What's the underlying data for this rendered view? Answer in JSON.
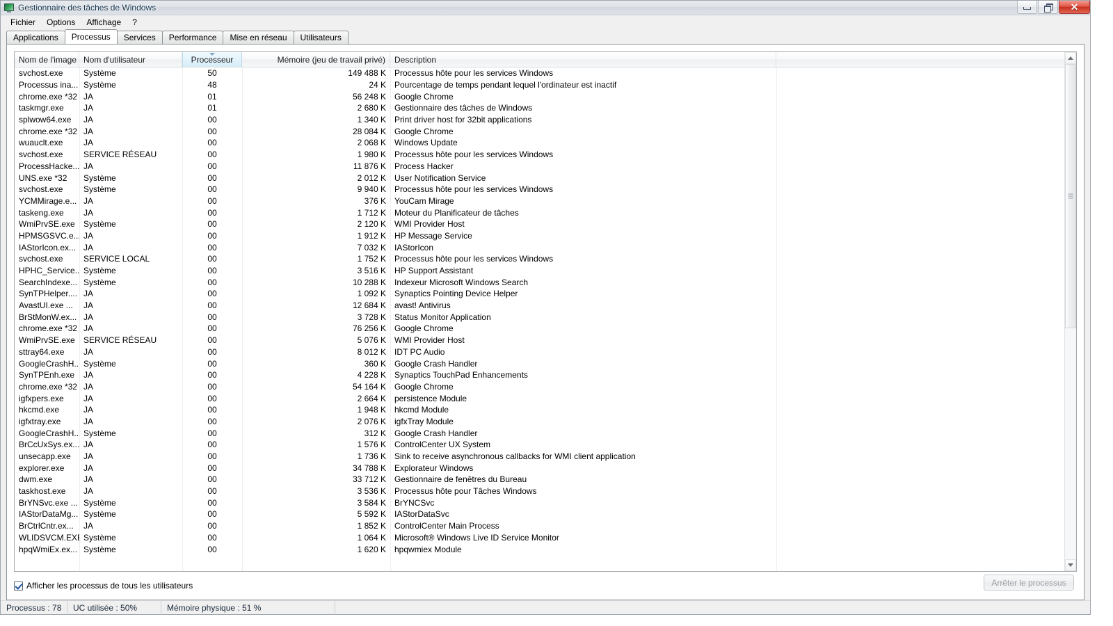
{
  "window": {
    "title": "Gestionnaire des tâches de Windows",
    "icon": "task-manager-icon",
    "minimize_label": "Réduire",
    "restore_label": "Agrandir",
    "close_label": "Fermer",
    "close_glyph": "✕"
  },
  "menu": {
    "items": [
      {
        "label": "Fichier"
      },
      {
        "label": "Options"
      },
      {
        "label": "Affichage"
      },
      {
        "label": "?"
      }
    ]
  },
  "tabs": [
    {
      "label": "Applications",
      "active": false
    },
    {
      "label": "Processus",
      "active": true
    },
    {
      "label": "Services",
      "active": false
    },
    {
      "label": "Performance",
      "active": false
    },
    {
      "label": "Mise en réseau",
      "active": false
    },
    {
      "label": "Utilisateurs",
      "active": false
    }
  ],
  "table": {
    "columns": [
      {
        "key": "name",
        "label": "Nom de l'image",
        "align": "left"
      },
      {
        "key": "user",
        "label": "Nom d'utilisateur",
        "align": "left"
      },
      {
        "key": "cpu",
        "label": "Processeur",
        "align": "center",
        "sorted": true,
        "sort_direction": "descending"
      },
      {
        "key": "mem",
        "label": "Mémoire (jeu de travail privé)",
        "align": "right"
      },
      {
        "key": "desc",
        "label": "Description",
        "align": "left"
      }
    ],
    "rows": [
      {
        "name": "svchost.exe",
        "user": "Système",
        "cpu": "50",
        "mem": "149 488 K",
        "desc": "Processus hôte pour les services Windows"
      },
      {
        "name": "Processus ina...",
        "user": "Système",
        "cpu": "48",
        "mem": "24 K",
        "desc": "Pourcentage de temps pendant lequel l'ordinateur est inactif"
      },
      {
        "name": "chrome.exe *32",
        "user": "JA",
        "cpu": "01",
        "mem": "56 248 K",
        "desc": "Google Chrome"
      },
      {
        "name": "taskmgr.exe",
        "user": "JA",
        "cpu": "01",
        "mem": "2 680 K",
        "desc": "Gestionnaire des tâches de Windows"
      },
      {
        "name": "splwow64.exe",
        "user": "JA",
        "cpu": "00",
        "mem": "1 340 K",
        "desc": "Print driver host for 32bit applications"
      },
      {
        "name": "chrome.exe *32",
        "user": "JA",
        "cpu": "00",
        "mem": "28 084 K",
        "desc": "Google Chrome"
      },
      {
        "name": "wuauclt.exe",
        "user": "JA",
        "cpu": "00",
        "mem": "2 068 K",
        "desc": "Windows Update"
      },
      {
        "name": "svchost.exe",
        "user": "SERVICE RÉSEAU",
        "cpu": "00",
        "mem": "1 980 K",
        "desc": "Processus hôte pour les services Windows"
      },
      {
        "name": "ProcessHacke...",
        "user": "JA",
        "cpu": "00",
        "mem": "11 876 K",
        "desc": "Process Hacker"
      },
      {
        "name": "UNS.exe *32",
        "user": "Système",
        "cpu": "00",
        "mem": "2 012 K",
        "desc": "User Notification Service"
      },
      {
        "name": "svchost.exe",
        "user": "Système",
        "cpu": "00",
        "mem": "9 940 K",
        "desc": "Processus hôte pour les services Windows"
      },
      {
        "name": "YCMMirage.e...",
        "user": "JA",
        "cpu": "00",
        "mem": "376 K",
        "desc": "YouCam Mirage"
      },
      {
        "name": "taskeng.exe",
        "user": "JA",
        "cpu": "00",
        "mem": "1 712 K",
        "desc": "Moteur du Planificateur de tâches"
      },
      {
        "name": "WmiPrvSE.exe",
        "user": "Système",
        "cpu": "00",
        "mem": "2 120 K",
        "desc": "WMI Provider Host"
      },
      {
        "name": "HPMSGSVC.e...",
        "user": "JA",
        "cpu": "00",
        "mem": "1 912 K",
        "desc": "HP Message Service"
      },
      {
        "name": "IAStorIcon.ex...",
        "user": "JA",
        "cpu": "00",
        "mem": "7 032 K",
        "desc": "IAStorIcon"
      },
      {
        "name": "svchost.exe",
        "user": "SERVICE LOCAL",
        "cpu": "00",
        "mem": "1 752 K",
        "desc": "Processus hôte pour les services Windows"
      },
      {
        "name": "HPHC_Service...",
        "user": "Système",
        "cpu": "00",
        "mem": "3 516 K",
        "desc": "HP Support Assistant"
      },
      {
        "name": "SearchIndexe...",
        "user": "Système",
        "cpu": "00",
        "mem": "10 288 K",
        "desc": "Indexeur Microsoft Windows Search"
      },
      {
        "name": "SynTPHelper....",
        "user": "JA",
        "cpu": "00",
        "mem": "1 092 K",
        "desc": "Synaptics Pointing Device Helper"
      },
      {
        "name": "AvastUI.exe ...",
        "user": "JA",
        "cpu": "00",
        "mem": "12 684 K",
        "desc": "avast! Antivirus"
      },
      {
        "name": "BrStMonW.ex...",
        "user": "JA",
        "cpu": "00",
        "mem": "3 728 K",
        "desc": "Status Monitor Application"
      },
      {
        "name": "chrome.exe *32",
        "user": "JA",
        "cpu": "00",
        "mem": "76 256 K",
        "desc": "Google Chrome"
      },
      {
        "name": "WmiPrvSE.exe",
        "user": "SERVICE RÉSEAU",
        "cpu": "00",
        "mem": "5 076 K",
        "desc": "WMI Provider Host"
      },
      {
        "name": "sttray64.exe",
        "user": "JA",
        "cpu": "00",
        "mem": "8 012 K",
        "desc": "IDT PC Audio"
      },
      {
        "name": "GoogleCrashH...",
        "user": "Système",
        "cpu": "00",
        "mem": "360 K",
        "desc": "Google Crash Handler"
      },
      {
        "name": "SynTPEnh.exe",
        "user": "JA",
        "cpu": "00",
        "mem": "4 228 K",
        "desc": "Synaptics TouchPad Enhancements"
      },
      {
        "name": "chrome.exe *32",
        "user": "JA",
        "cpu": "00",
        "mem": "54 164 K",
        "desc": "Google Chrome"
      },
      {
        "name": "igfxpers.exe",
        "user": "JA",
        "cpu": "00",
        "mem": "2 664 K",
        "desc": "persistence Module"
      },
      {
        "name": "hkcmd.exe",
        "user": "JA",
        "cpu": "00",
        "mem": "1 948 K",
        "desc": "hkcmd Module"
      },
      {
        "name": "igfxtray.exe",
        "user": "JA",
        "cpu": "00",
        "mem": "2 076 K",
        "desc": "igfxTray Module"
      },
      {
        "name": "GoogleCrashH...",
        "user": "Système",
        "cpu": "00",
        "mem": "312 K",
        "desc": "Google Crash Handler"
      },
      {
        "name": "BrCcUxSys.ex...",
        "user": "JA",
        "cpu": "00",
        "mem": "1 576 K",
        "desc": "ControlCenter UX System"
      },
      {
        "name": "unsecapp.exe",
        "user": "JA",
        "cpu": "00",
        "mem": "1 736 K",
        "desc": "Sink to receive asynchronous callbacks for WMI client application"
      },
      {
        "name": "explorer.exe",
        "user": "JA",
        "cpu": "00",
        "mem": "34 788 K",
        "desc": "Explorateur Windows"
      },
      {
        "name": "dwm.exe",
        "user": "JA",
        "cpu": "00",
        "mem": "33 712 K",
        "desc": "Gestionnaire de fenêtres du Bureau"
      },
      {
        "name": "taskhost.exe",
        "user": "JA",
        "cpu": "00",
        "mem": "3 536 K",
        "desc": "Processus hôte pour Tâches Windows"
      },
      {
        "name": "BrYNSvc.exe ...",
        "user": "Système",
        "cpu": "00",
        "mem": "3 584 K",
        "desc": "BrYNCSvc"
      },
      {
        "name": "IAStorDataMg...",
        "user": "Système",
        "cpu": "00",
        "mem": "5 592 K",
        "desc": "IAStorDataSvc"
      },
      {
        "name": "BrCtrlCntr.ex...",
        "user": "JA",
        "cpu": "00",
        "mem": "1 852 K",
        "desc": "ControlCenter Main Process"
      },
      {
        "name": "WLIDSVCM.EXE",
        "user": "Système",
        "cpu": "00",
        "mem": "1 064 K",
        "desc": "Microsoft® Windows Live ID Service Monitor"
      },
      {
        "name": "hpqWmiEx.ex...",
        "user": "Système",
        "cpu": "00",
        "mem": "1 620 K",
        "desc": "hpqwmiex Module"
      }
    ]
  },
  "footer": {
    "show_all_users_label": "Afficher les processus de tous les utilisateurs",
    "show_all_users_checked": true,
    "end_process_label": "Arrêter le processus",
    "end_process_enabled": false
  },
  "statusbar": {
    "processes": "Processus : 78",
    "cpu_usage": "UC utilisée : 50%",
    "physical_memory": "Mémoire physique : 51 %"
  },
  "scrollbar": {
    "up_label": "Défiler vers le haut",
    "down_label": "Défiler vers le bas"
  }
}
